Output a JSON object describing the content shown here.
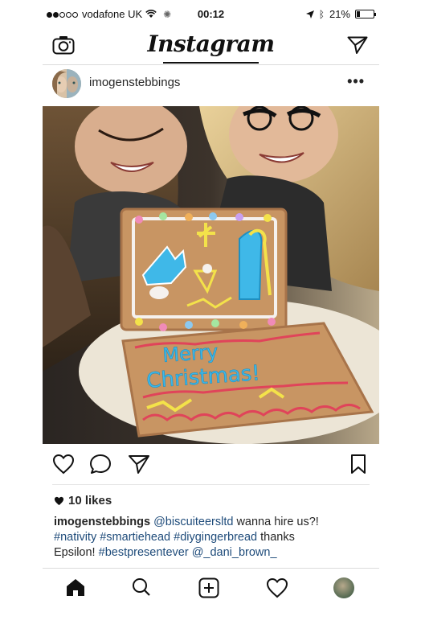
{
  "status_bar": {
    "carrier": "vodafone UK",
    "time": "00:12",
    "battery": "21%",
    "battery_level": 0.21
  },
  "header": {
    "logo": "Instagram",
    "icons": [
      "camera-icon",
      "direct-message-icon"
    ]
  },
  "post": {
    "username": "imogenstebbings",
    "more_label": "•••",
    "likes": "10 likes",
    "caption": {
      "username": "imogenstebbings",
      "mention1": "@biscuiteersltd",
      "text1": " wanna hire us?!",
      "tag1": "#nativity",
      "tag2": "#smartiehead",
      "tag3": "#diygingerbread",
      "text2": " thanks",
      "text3": "Epsilon! ",
      "tag4": "#bestpresentever",
      "mention2": "@_dani_brown_"
    },
    "photo": {
      "cookie_text": "Merry Christmas!",
      "colors": {
        "icing_blue": "#3fb8e8",
        "icing_red": "#e0445a",
        "icing_yellow": "#f3e24a",
        "gingerbread": "#c89563"
      }
    }
  },
  "actions": [
    "heart-icon",
    "comment-icon",
    "share-icon",
    "bookmark-icon"
  ],
  "tab_bar": [
    "home-icon",
    "search-icon",
    "add-post-icon",
    "activity-icon",
    "profile-icon"
  ]
}
